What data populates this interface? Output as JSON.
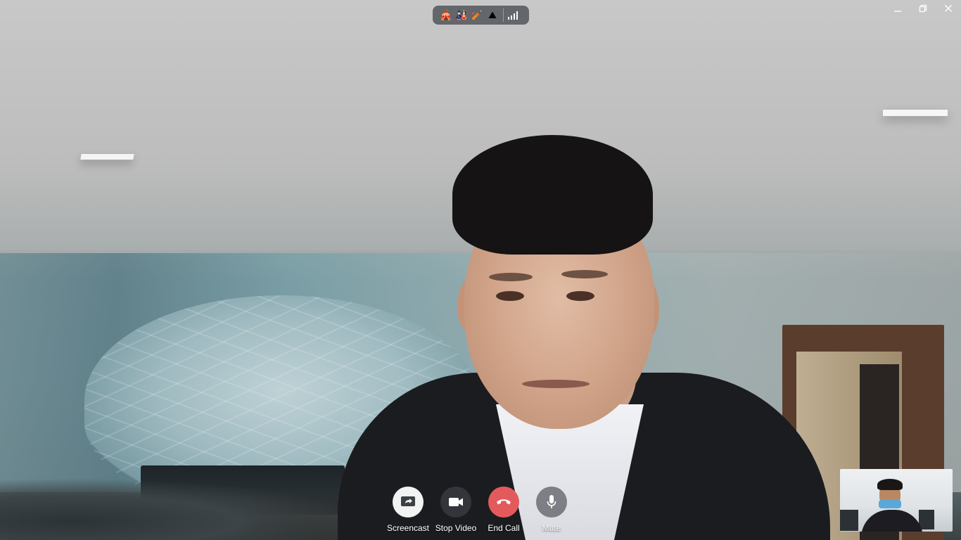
{
  "top_bar": {
    "emoji_icons": [
      "🎪",
      "🎎",
      "🏏",
      "⛰"
    ],
    "signal_icon": "signal-strength-icon"
  },
  "window_controls": {
    "minimize": "—",
    "restore": "❐",
    "close": "✕"
  },
  "controls": [
    {
      "name": "screencast-button",
      "label": "Screencast",
      "icon": "screencast-icon"
    },
    {
      "name": "stop-video-button",
      "label": "Stop Video",
      "icon": "video-camera-icon"
    },
    {
      "name": "end-call-button",
      "label": "End Call",
      "icon": "phone-hangup-icon",
      "color": "#e35a5d"
    },
    {
      "name": "mute-button",
      "label": "Mute",
      "icon": "microphone-icon"
    }
  ]
}
